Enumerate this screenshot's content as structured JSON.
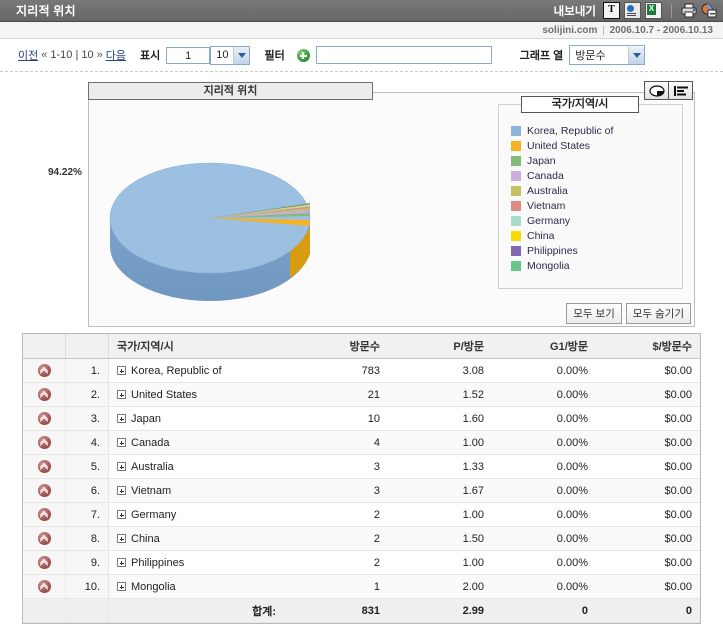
{
  "titlebar": {
    "title": "지리적 위치",
    "export_label": "내보내기",
    "icons": {
      "text": "T",
      "web": "web-export-icon",
      "excel": "excel-export-icon",
      "print": "print-icon",
      "help": "help-icon"
    }
  },
  "subbar": {
    "site": "solijini.com",
    "separator": "|",
    "date_range": "2006.10.7 - 2006.10.13"
  },
  "controls": {
    "prev": "이전",
    "prev_chevrons": "«",
    "page_range": "1-10 | 10",
    "next_chevrons": "»",
    "next": "다음",
    "display_label": "표시",
    "display_start": "1",
    "display_count": "10",
    "filter_label": "필터",
    "filter_value": "",
    "filter_placeholder": "",
    "graph_column_label": "그래프 열",
    "graph_column_value": "방문수"
  },
  "chart": {
    "title": "지리적 위치",
    "legend_title": "국가/지역/시",
    "main_pct": "94.22%",
    "show_all": "모두 보기",
    "hide_all": "모두 숨기기",
    "toolbar": {
      "pie": "pie-chart-icon",
      "bar": "bar-chart-icon"
    }
  },
  "chart_data": {
    "type": "pie",
    "title": "지리적 위치",
    "legend_title": "국가/지역/시",
    "legend_position": "right",
    "labels": [
      "94.22%"
    ],
    "categories": [
      "Korea, Republic of",
      "United States",
      "Japan",
      "Canada",
      "Australia",
      "Vietnam",
      "Germany",
      "China",
      "Philippines",
      "Mongolia"
    ],
    "values": [
      783,
      21,
      10,
      4,
      3,
      3,
      2,
      2,
      2,
      1
    ],
    "percentages": [
      94.22,
      2.53,
      1.2,
      0.48,
      0.36,
      0.36,
      0.24,
      0.24,
      0.24,
      0.12
    ],
    "colors": [
      "#8cb4dc",
      "#f5b324",
      "#85bb7a",
      "#cbaed8",
      "#c4c06a",
      "#e08a82",
      "#a8dcc8",
      "#fdd902",
      "#8068b4",
      "#66c68e"
    ],
    "total": 831
  },
  "table": {
    "headers": {
      "index": "",
      "rank": "",
      "name": "국가/지역/시",
      "visits": "방문수",
      "pages_per_visit": "P/방문",
      "g1_per_visit": "G1/방문",
      "dollars_per_visit": "$/방문수"
    },
    "rows": [
      {
        "rank": "1.",
        "name": "Korea, Republic of",
        "visits": "783",
        "pv": "3.08",
        "g1": "0.00%",
        "dollars": "$0.00"
      },
      {
        "rank": "2.",
        "name": "United States",
        "visits": "21",
        "pv": "1.52",
        "g1": "0.00%",
        "dollars": "$0.00"
      },
      {
        "rank": "3.",
        "name": "Japan",
        "visits": "10",
        "pv": "1.60",
        "g1": "0.00%",
        "dollars": "$0.00"
      },
      {
        "rank": "4.",
        "name": "Canada",
        "visits": "4",
        "pv": "1.00",
        "g1": "0.00%",
        "dollars": "$0.00"
      },
      {
        "rank": "5.",
        "name": "Australia",
        "visits": "3",
        "pv": "1.33",
        "g1": "0.00%",
        "dollars": "$0.00"
      },
      {
        "rank": "6.",
        "name": "Vietnam",
        "visits": "3",
        "pv": "1.67",
        "g1": "0.00%",
        "dollars": "$0.00"
      },
      {
        "rank": "7.",
        "name": "Germany",
        "visits": "2",
        "pv": "1.00",
        "g1": "0.00%",
        "dollars": "$0.00"
      },
      {
        "rank": "8.",
        "name": "China",
        "visits": "2",
        "pv": "1.50",
        "g1": "0.00%",
        "dollars": "$0.00"
      },
      {
        "rank": "9.",
        "name": "Philippines",
        "visits": "2",
        "pv": "1.00",
        "g1": "0.00%",
        "dollars": "$0.00"
      },
      {
        "rank": "10.",
        "name": "Mongolia",
        "visits": "1",
        "pv": "2.00",
        "g1": "0.00%",
        "dollars": "$0.00"
      }
    ],
    "totals": {
      "label": "합계:",
      "visits": "831",
      "pv": "2.99",
      "g1": "0",
      "dollars": "0"
    }
  }
}
